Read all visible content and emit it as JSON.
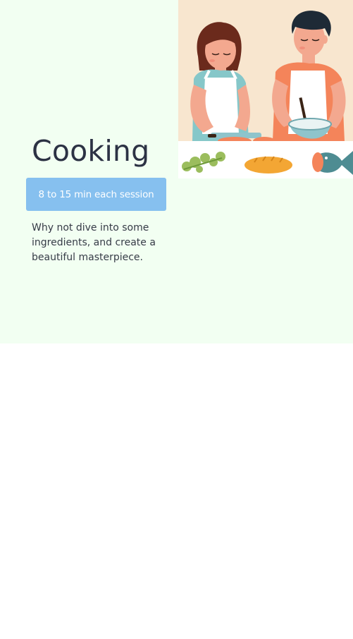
{
  "card": {
    "title": "Cooking",
    "duration_label": "8 to 15 min each session",
    "description": "Why not dive into some ingredients, and create a beautiful masterpiece.",
    "illustration": {
      "icon": "couple-cooking-illustration",
      "colors": {
        "background": "#f8e6cf",
        "counter": "#ffffff",
        "skin": "#f3a88f",
        "hair": "#2b1c1a",
        "apron": "#ffffff",
        "shirt_left": "#86c7c9",
        "shirt_right": "#f4845a",
        "bowl": "#8fc4cb",
        "fish": "#4e8c92",
        "bread": "#f3a634",
        "greens": "#9bbd5d"
      }
    },
    "colors": {
      "card_background": "#f2fff2",
      "button_background": "#86c0ef",
      "button_text": "#ffffff",
      "title_text": "#2c3244",
      "body_text": "#363b47"
    }
  }
}
